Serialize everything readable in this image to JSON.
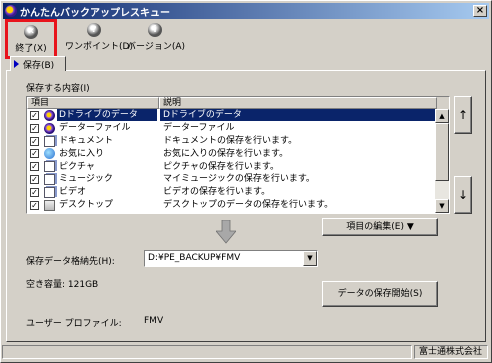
{
  "window": {
    "title": "かんたんバックアップレスキュー",
    "close": "×"
  },
  "toolbar": {
    "exit": {
      "icon": "close-circle-icon",
      "label": "終了(X)"
    },
    "onepoint": {
      "icon": "question-circle-icon",
      "label": "ワンポイント(D)"
    },
    "version": {
      "icon": "info-circle-icon",
      "label": "バージョン(A)"
    }
  },
  "tab": {
    "label": "保存(B)"
  },
  "backup": {
    "section_label": "保存する内容(I)",
    "columns": [
      "項目",
      "説明"
    ],
    "items": [
      {
        "checked": true,
        "icon": "drive-icon",
        "name": "Dドライブのデータ",
        "desc": "Dドライブのデータ",
        "selected": true
      },
      {
        "checked": true,
        "icon": "drive-icon",
        "name": "データーファイル",
        "desc": "データーファイル"
      },
      {
        "checked": true,
        "icon": "document-icon",
        "name": "ドキュメント",
        "desc": "ドキュメントの保存を行います。"
      },
      {
        "checked": true,
        "icon": "globe-icon",
        "name": "お気に入り",
        "desc": "お気に入りの保存を行います。"
      },
      {
        "checked": true,
        "icon": "document-icon",
        "name": "ピクチャ",
        "desc": "ピクチャの保存を行います。"
      },
      {
        "checked": true,
        "icon": "document-icon",
        "name": "ミュージック",
        "desc": "マイミュージックの保存を行います。"
      },
      {
        "checked": true,
        "icon": "document-icon",
        "name": "ビデオ",
        "desc": "ビデオの保存を行います。"
      },
      {
        "checked": true,
        "icon": "page-icon",
        "name": "デスクトップ",
        "desc": "デスクトップのデータの保存を行います。"
      }
    ],
    "move_up": "↑",
    "move_down": "↓",
    "edit_button": "項目の編集(E) ▼"
  },
  "destination": {
    "label": "保存データ格納先(H):",
    "value": "D:¥PE_BACKUP¥FMV",
    "free_space": "空き容量: 121GB",
    "start_button": "データの保存開始(S)",
    "profile_label": "ユーザー プロファイル:",
    "profile_value": "FMV"
  },
  "status": {
    "left": "",
    "right": "富士通株式会社"
  }
}
